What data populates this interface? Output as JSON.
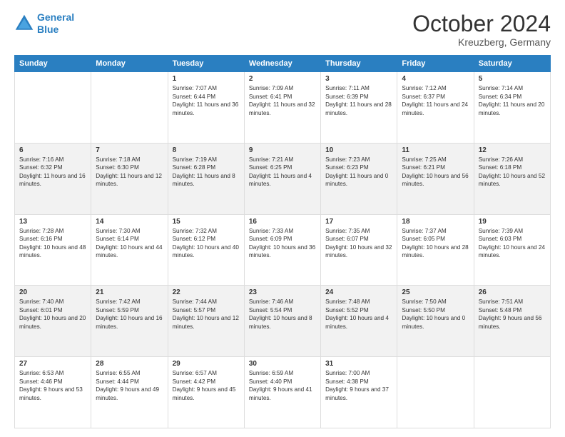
{
  "header": {
    "logo_line1": "General",
    "logo_line2": "Blue",
    "title": "October 2024",
    "subtitle": "Kreuzberg, Germany"
  },
  "days_of_week": [
    "Sunday",
    "Monday",
    "Tuesday",
    "Wednesday",
    "Thursday",
    "Friday",
    "Saturday"
  ],
  "weeks": [
    [
      {
        "day": "",
        "text": ""
      },
      {
        "day": "",
        "text": ""
      },
      {
        "day": "1",
        "text": "Sunrise: 7:07 AM\nSunset: 6:44 PM\nDaylight: 11 hours and 36 minutes."
      },
      {
        "day": "2",
        "text": "Sunrise: 7:09 AM\nSunset: 6:41 PM\nDaylight: 11 hours and 32 minutes."
      },
      {
        "day": "3",
        "text": "Sunrise: 7:11 AM\nSunset: 6:39 PM\nDaylight: 11 hours and 28 minutes."
      },
      {
        "day": "4",
        "text": "Sunrise: 7:12 AM\nSunset: 6:37 PM\nDaylight: 11 hours and 24 minutes."
      },
      {
        "day": "5",
        "text": "Sunrise: 7:14 AM\nSunset: 6:34 PM\nDaylight: 11 hours and 20 minutes."
      }
    ],
    [
      {
        "day": "6",
        "text": "Sunrise: 7:16 AM\nSunset: 6:32 PM\nDaylight: 11 hours and 16 minutes."
      },
      {
        "day": "7",
        "text": "Sunrise: 7:18 AM\nSunset: 6:30 PM\nDaylight: 11 hours and 12 minutes."
      },
      {
        "day": "8",
        "text": "Sunrise: 7:19 AM\nSunset: 6:28 PM\nDaylight: 11 hours and 8 minutes."
      },
      {
        "day": "9",
        "text": "Sunrise: 7:21 AM\nSunset: 6:25 PM\nDaylight: 11 hours and 4 minutes."
      },
      {
        "day": "10",
        "text": "Sunrise: 7:23 AM\nSunset: 6:23 PM\nDaylight: 11 hours and 0 minutes."
      },
      {
        "day": "11",
        "text": "Sunrise: 7:25 AM\nSunset: 6:21 PM\nDaylight: 10 hours and 56 minutes."
      },
      {
        "day": "12",
        "text": "Sunrise: 7:26 AM\nSunset: 6:18 PM\nDaylight: 10 hours and 52 minutes."
      }
    ],
    [
      {
        "day": "13",
        "text": "Sunrise: 7:28 AM\nSunset: 6:16 PM\nDaylight: 10 hours and 48 minutes."
      },
      {
        "day": "14",
        "text": "Sunrise: 7:30 AM\nSunset: 6:14 PM\nDaylight: 10 hours and 44 minutes."
      },
      {
        "day": "15",
        "text": "Sunrise: 7:32 AM\nSunset: 6:12 PM\nDaylight: 10 hours and 40 minutes."
      },
      {
        "day": "16",
        "text": "Sunrise: 7:33 AM\nSunset: 6:09 PM\nDaylight: 10 hours and 36 minutes."
      },
      {
        "day": "17",
        "text": "Sunrise: 7:35 AM\nSunset: 6:07 PM\nDaylight: 10 hours and 32 minutes."
      },
      {
        "day": "18",
        "text": "Sunrise: 7:37 AM\nSunset: 6:05 PM\nDaylight: 10 hours and 28 minutes."
      },
      {
        "day": "19",
        "text": "Sunrise: 7:39 AM\nSunset: 6:03 PM\nDaylight: 10 hours and 24 minutes."
      }
    ],
    [
      {
        "day": "20",
        "text": "Sunrise: 7:40 AM\nSunset: 6:01 PM\nDaylight: 10 hours and 20 minutes."
      },
      {
        "day": "21",
        "text": "Sunrise: 7:42 AM\nSunset: 5:59 PM\nDaylight: 10 hours and 16 minutes."
      },
      {
        "day": "22",
        "text": "Sunrise: 7:44 AM\nSunset: 5:57 PM\nDaylight: 10 hours and 12 minutes."
      },
      {
        "day": "23",
        "text": "Sunrise: 7:46 AM\nSunset: 5:54 PM\nDaylight: 10 hours and 8 minutes."
      },
      {
        "day": "24",
        "text": "Sunrise: 7:48 AM\nSunset: 5:52 PM\nDaylight: 10 hours and 4 minutes."
      },
      {
        "day": "25",
        "text": "Sunrise: 7:50 AM\nSunset: 5:50 PM\nDaylight: 10 hours and 0 minutes."
      },
      {
        "day": "26",
        "text": "Sunrise: 7:51 AM\nSunset: 5:48 PM\nDaylight: 9 hours and 56 minutes."
      }
    ],
    [
      {
        "day": "27",
        "text": "Sunrise: 6:53 AM\nSunset: 4:46 PM\nDaylight: 9 hours and 53 minutes."
      },
      {
        "day": "28",
        "text": "Sunrise: 6:55 AM\nSunset: 4:44 PM\nDaylight: 9 hours and 49 minutes."
      },
      {
        "day": "29",
        "text": "Sunrise: 6:57 AM\nSunset: 4:42 PM\nDaylight: 9 hours and 45 minutes."
      },
      {
        "day": "30",
        "text": "Sunrise: 6:59 AM\nSunset: 4:40 PM\nDaylight: 9 hours and 41 minutes."
      },
      {
        "day": "31",
        "text": "Sunrise: 7:00 AM\nSunset: 4:38 PM\nDaylight: 9 hours and 37 minutes."
      },
      {
        "day": "",
        "text": ""
      },
      {
        "day": "",
        "text": ""
      }
    ]
  ]
}
